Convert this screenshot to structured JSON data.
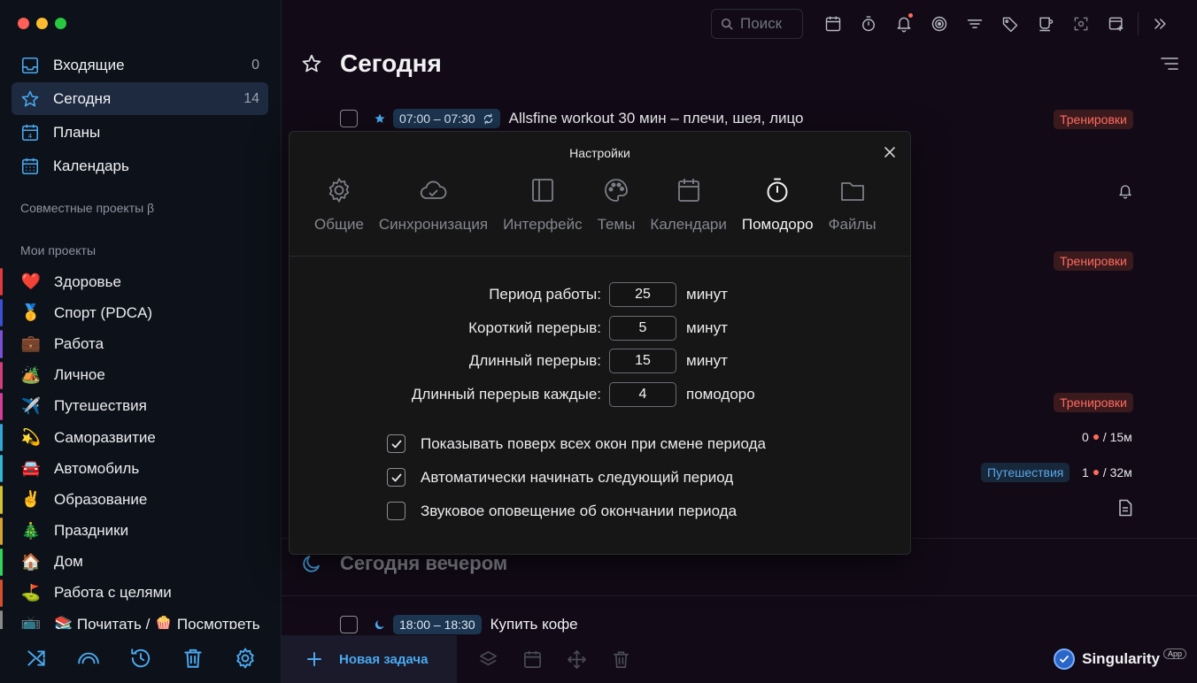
{
  "sidebar": {
    "nav": [
      {
        "label": "Входящие",
        "count": "0",
        "icon": "inbox-icon"
      },
      {
        "label": "Сегодня",
        "count": "14",
        "icon": "star-icon"
      },
      {
        "label": "Планы",
        "count": "",
        "icon": "calendar-day-icon"
      },
      {
        "label": "Календарь",
        "count": "",
        "icon": "calendar-grid-icon"
      }
    ],
    "shared_title": "Совместные проекты β",
    "my_title": "Мои проекты",
    "projects": [
      {
        "emoji": "❤️",
        "label": "Здоровье",
        "color": "#e23b3b"
      },
      {
        "emoji": "🥇",
        "label": "Спорт (PDCA)",
        "color": "#3d4fd6"
      },
      {
        "emoji": "💼",
        "label": "Работа",
        "color": "#7a4fd6"
      },
      {
        "emoji": "🏕️",
        "label": "Личное",
        "color": "#d63d7a"
      },
      {
        "emoji": "✈️",
        "label": "Путешествия",
        "color": "#d63d96"
      },
      {
        "emoji": "💫",
        "label": "Саморазвитие",
        "color": "#2fa8d6"
      },
      {
        "emoji": "🚘",
        "label": "Автомобиль",
        "color": "#2fb7d6"
      },
      {
        "emoji": "✌️",
        "label": "Образование",
        "color": "#d6c12f"
      },
      {
        "emoji": "🎄",
        "label": "Праздники",
        "color": "#d6a52f"
      },
      {
        "emoji": "🏠",
        "label": "Дом",
        "color": "#2fd65a"
      },
      {
        "emoji": "⛳",
        "label": "Работа с целями",
        "color": "#d6502f"
      },
      {
        "emoji": "📺",
        "label": "📚 Почитать / 🍿 Посмотреть",
        "color": "#8a8a8a"
      }
    ]
  },
  "toolbar": {
    "search_placeholder": "Поиск"
  },
  "main": {
    "title": "Сегодня",
    "task1": {
      "time": "07:00 – 07:30",
      "name": "Allsfine workout 30 мин – плечи, шея, лицо"
    },
    "tags": {
      "t1": "Тренировки",
      "t2": "Тренировки",
      "t3": "Тренировки",
      "t4": "Путешествия"
    },
    "meta1": {
      "a": "0",
      "b": "/ 15м"
    },
    "meta2": {
      "a": "1",
      "b": "/ 32м"
    },
    "evening_title": "Сегодня вечером",
    "task2": {
      "time": "18:00 – 18:30",
      "name": "Купить кофе"
    }
  },
  "bottom": {
    "new_task": "Новая задача",
    "brand": "Singularity",
    "brand_badge": "App"
  },
  "modal": {
    "title": "Настройки",
    "tabs": [
      {
        "label": "Общие",
        "icon": "gear-icon",
        "active": false
      },
      {
        "label": "Синхронизация",
        "icon": "cloud-sync-icon",
        "active": false
      },
      {
        "label": "Интерфейс",
        "icon": "layout-icon",
        "active": false
      },
      {
        "label": "Темы",
        "icon": "palette-icon",
        "active": false
      },
      {
        "label": "Календари",
        "icon": "calendar-icon",
        "active": false
      },
      {
        "label": "Помодоро",
        "icon": "stopwatch-icon",
        "active": true
      },
      {
        "label": "Файлы",
        "icon": "folder-icon",
        "active": false
      }
    ],
    "fields": [
      {
        "label": "Период работы:",
        "value": "25",
        "unit": "минут"
      },
      {
        "label": "Короткий перерыв:",
        "value": "5",
        "unit": "минут"
      },
      {
        "label": "Длинный перерыв:",
        "value": "15",
        "unit": "минут"
      },
      {
        "label": "Длинный перерыв каждые:",
        "value": "4",
        "unit": "помодоро"
      }
    ],
    "checks": [
      {
        "label": "Показывать поверх всех окон при смене периода",
        "checked": true
      },
      {
        "label": "Автоматически начинать следующий период",
        "checked": true
      },
      {
        "label": "Звуковое оповещение об окончании периода",
        "checked": false
      }
    ]
  }
}
